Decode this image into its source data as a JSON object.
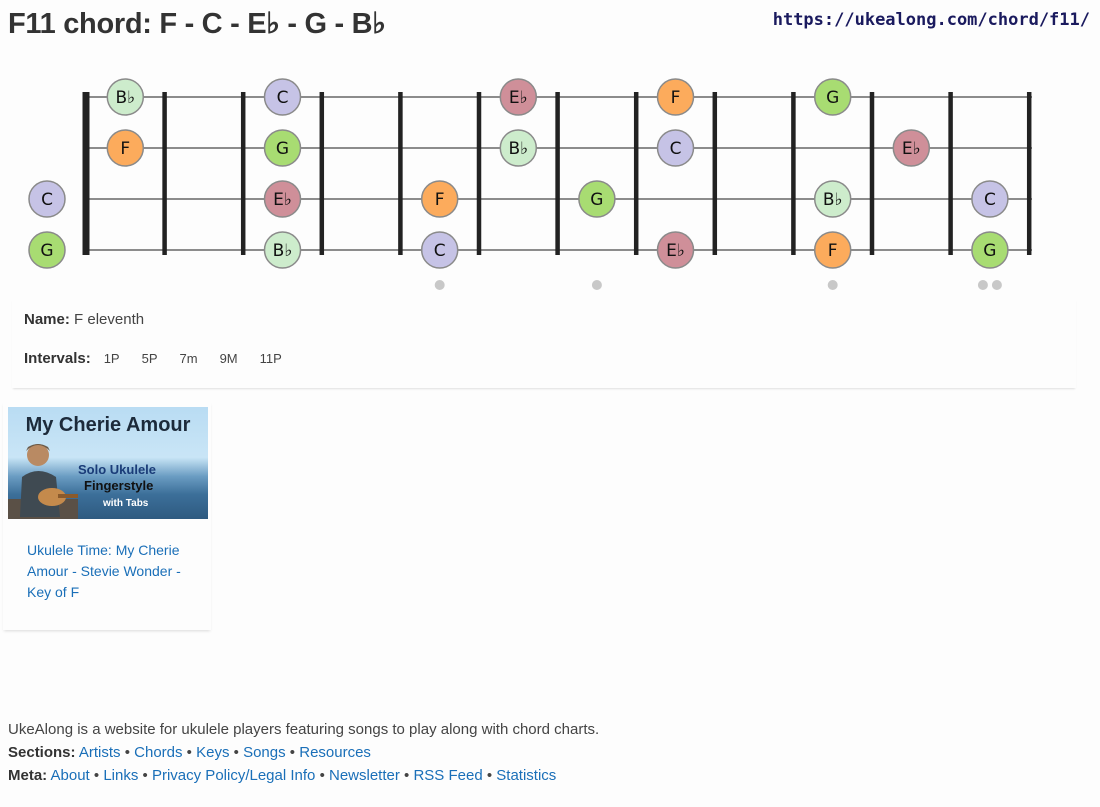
{
  "header": {
    "title": "F11 chord: F - C - E♭ - G - B♭",
    "url": "https://ukealong.com/chord/f11/"
  },
  "fretboard": {
    "string_count": 4,
    "note_colors": {
      "F": "#fcab5c",
      "C": "#c6c3e6",
      "E♭": "#cf8f99",
      "G": "#a8dc72",
      "B♭": "#cdeccc"
    },
    "notes": [
      {
        "label": "C",
        "string": 2,
        "fret": 0
      },
      {
        "label": "G",
        "string": 3,
        "fret": 0
      },
      {
        "label": "B♭",
        "string": 0,
        "fret": 1
      },
      {
        "label": "F",
        "string": 1,
        "fret": 1
      },
      {
        "label": "C",
        "string": 0,
        "fret": 3
      },
      {
        "label": "G",
        "string": 1,
        "fret": 3
      },
      {
        "label": "E♭",
        "string": 2,
        "fret": 3
      },
      {
        "label": "B♭",
        "string": 3,
        "fret": 3
      },
      {
        "label": "F",
        "string": 2,
        "fret": 5
      },
      {
        "label": "C",
        "string": 3,
        "fret": 5
      },
      {
        "label": "E♭",
        "string": 0,
        "fret": 6
      },
      {
        "label": "B♭",
        "string": 1,
        "fret": 6
      },
      {
        "label": "G",
        "string": 2,
        "fret": 7
      },
      {
        "label": "F",
        "string": 0,
        "fret": 8
      },
      {
        "label": "C",
        "string": 1,
        "fret": 8
      },
      {
        "label": "E♭",
        "string": 3,
        "fret": 8
      },
      {
        "label": "G",
        "string": 0,
        "fret": 10
      },
      {
        "label": "B♭",
        "string": 2,
        "fret": 10
      },
      {
        "label": "F",
        "string": 3,
        "fret": 10
      },
      {
        "label": "E♭",
        "string": 1,
        "fret": 11
      },
      {
        "label": "C",
        "string": 2,
        "fret": 12
      },
      {
        "label": "G",
        "string": 3,
        "fret": 12
      }
    ],
    "fret_markers": [
      {
        "fret": 5,
        "count": 1
      },
      {
        "fret": 7,
        "count": 1
      },
      {
        "fret": 10,
        "count": 1
      },
      {
        "fret": 12,
        "count": 2
      }
    ]
  },
  "chord_info": {
    "name_label": "Name:",
    "name_value": "F eleventh",
    "intervals_label": "Intervals:",
    "intervals": [
      "1P",
      "5P",
      "7m",
      "9M",
      "11P"
    ]
  },
  "video": {
    "thumb_title": "My Cherie Amour",
    "thumb_line1": "Solo Ukulele",
    "thumb_line2": "Fingerstyle",
    "thumb_line3": "with Tabs",
    "link_text": "Ukulele Time: My Cherie Amour - Stevie Wonder - Key of F"
  },
  "footer": {
    "tagline": "UkeAlong is a website for ukulele players featuring songs to play along with chord charts.",
    "sections_label": "Sections:",
    "sections": [
      "Artists",
      "Chords",
      "Keys",
      "Songs",
      "Resources"
    ],
    "meta_label": "Meta:",
    "meta": [
      "About",
      "Links",
      "Privacy Policy/Legal Info",
      "Newsletter",
      "RSS Feed",
      "Statistics"
    ]
  }
}
